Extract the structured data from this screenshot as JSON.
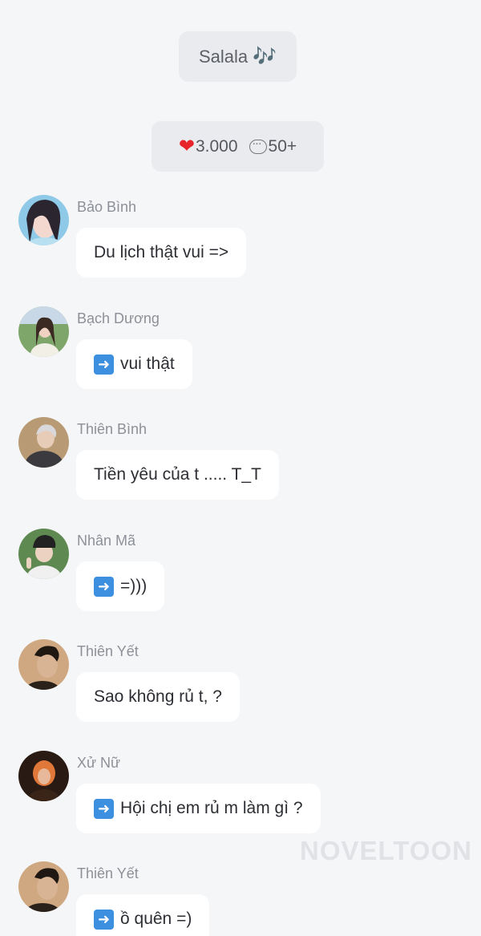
{
  "header": {
    "title": "Salala",
    "title_icon": "🎶",
    "likes": "3.000",
    "likes_icon": "heart-icon",
    "comments": "50+",
    "comments_icon": "comment-bubble-icon"
  },
  "messages": [
    {
      "name": "Bảo Bình",
      "text": "Du lịch thật vui =>",
      "arrow": false
    },
    {
      "name": "Bạch Dương",
      "text": "vui thật",
      "arrow": true
    },
    {
      "name": "Thiên Bình",
      "text": "Tiền yêu của t ..... T_T",
      "arrow": false
    },
    {
      "name": "Nhân Mã",
      "text": "=)))",
      "arrow": true
    },
    {
      "name": "Thiên Yết",
      "text": "Sao không rủ t, ?",
      "arrow": false
    },
    {
      "name": "Xử Nữ",
      "text": "Hội chị em rủ m làm gì ?",
      "arrow": true
    },
    {
      "name": "Thiên Yết",
      "text": "ồ quên =)",
      "arrow": true
    }
  ],
  "watermark": "NOVELTOON",
  "colors": {
    "background": "#f5f6f8",
    "pill": "#eaebee",
    "bubble": "#ffffff",
    "arrow_emoji": "#3d8fe0",
    "heart": "#e8242b"
  }
}
